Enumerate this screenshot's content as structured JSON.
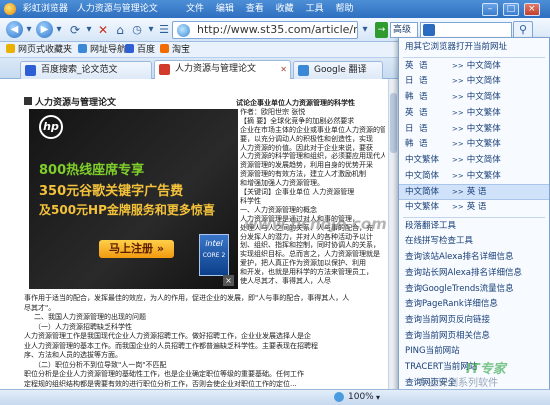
{
  "titlebar": {
    "app_name": "彩虹浏览器",
    "page_title": "人力资源与管理论文",
    "menu": [
      "文件",
      "编辑",
      "查看",
      "收藏",
      "工具",
      "帮助"
    ]
  },
  "address": {
    "url": "http://www.st35.com/article/manag",
    "go_label": "→",
    "engine": "高级",
    "search_value": ""
  },
  "favorites": [
    "网页式收藏夹",
    "网址导航",
    "百度",
    "淘宝"
  ],
  "tabs": [
    {
      "label": "百度搜索_论文范文",
      "active": false
    },
    {
      "label": "人力资源与管理论文",
      "active": true
    },
    {
      "label": "Google 翻译",
      "active": false
    }
  ],
  "document": {
    "heading": "人力资源与管理论文",
    "lines_right": [
      "试论企事业单位人力资源管理的科学性",
      "作者：欧阳世宗    张悦",
      "【摘 要】全球化竞争的加剧必然要求",
      "企业在市场主体的企业或事业单位人力资源的管理",
      "要，以充分调动人的积极性和创造性，实现",
      "人力资源的价值。因此对于企业来说，要获",
      "人力资源的科学管理和组织，必须要应用现代人力",
      "资源管理的发展趋势，利用自身的优势开采",
      "资源管理的有效方法，建立人才激励机制",
      "和增强加强人力资源管理。",
      "【关键词】企事业单位 人力资源管理",
      "科学性",
      "一、人力资源管理的概念",
      "人力资源管理是通过对人和事的管理，",
      "处理人与人之间的关系、人与事的配合，充",
      "分发挥人的潜力，并对人的各种活动予以计",
      "划、组织、指挥和控制，同时协调人的关系，",
      "实现组织目标。总而言之，人力资源管理就是",
      "爱护，把人真正作为资源加以保护、利用",
      "和开发，也就是用科学的方法来管理员工，",
      "使人尽其才、事得其人，人尽"
    ],
    "lines_full": [
      "事作用于适当的配合，发挥最佳的效应，为人的作用，促进企业的发展，即\"人与事的配合，事得其人，人",
      "尽其才\"。",
      "二、我国人力资源管理的出现的问题",
      "（一）人力资源招聘缺乏科学性",
      "人力资源管理工作是我国现代企业人力资源招聘工作。做好招聘工作，企业业发展选择人是企",
      "业人力资源管理的基本工作。而我国企业的人员招聘工作都普遍缺乏科学性。主要表现在招聘程",
      "序、方法和人员的选拔等方面。",
      "（二）职位分析不到位导致\"人一岗\"不匹配",
      "职位分析是企业人力资源管理的基础性工作，也是企业确定职位等级的重要基础。任何工作",
      "定程规的组织结构都是需要有效的进行职位分析工作，否则会使企业对职位工作的定位..."
    ]
  },
  "ad": {
    "brand": "hp",
    "line1": "800热线座席专享",
    "line2": "350元谷歌关键字广告费",
    "line3": "及500元HP金牌服务和更多惊喜",
    "button": "马上注册",
    "button_arrows": "»",
    "badge_line1": "intel",
    "badge_line2": "CORE 2",
    "close": "×"
  },
  "watermarks": {
    "main": "www.pcnoje.com",
    "green": "IT专家",
    "gray": "专业评测系列软件"
  },
  "dropdown": {
    "items": [
      {
        "type": "header",
        "label": "用其它浏览器打开当前网址"
      },
      {
        "type": "trans",
        "from": "英",
        "to": "语",
        "target": "中文简体"
      },
      {
        "type": "trans",
        "from": "日",
        "to": "语",
        "target": "中文简体"
      },
      {
        "type": "trans",
        "from": "韩",
        "to": "语",
        "target": "中文简体"
      },
      {
        "type": "trans",
        "from": "英",
        "to": "语",
        "target": "中文繁体"
      },
      {
        "type": "trans",
        "from": "日",
        "to": "语",
        "target": "中文繁体"
      },
      {
        "type": "trans",
        "from": "韩",
        "to": "语",
        "target": "中文繁体"
      },
      {
        "type": "trans",
        "from": "中文繁体",
        "to": "",
        "target": "中文简体"
      },
      {
        "type": "trans",
        "from": "中文简体",
        "to": "",
        "target": "中文繁体"
      },
      {
        "type": "trans",
        "from": "中文简体",
        "to": "",
        "target": "英   语",
        "selected": true
      },
      {
        "type": "trans",
        "from": "中文繁体",
        "to": "",
        "target": "英   语"
      },
      {
        "type": "plain",
        "label": "段落翻译工具"
      },
      {
        "type": "plain",
        "label": "在线拼写检查工具"
      },
      {
        "type": "plain",
        "label": "查询该站Alexa排名详细信息"
      },
      {
        "type": "plain",
        "label": "查询站长网Alexa排名详细信息"
      },
      {
        "type": "plain",
        "label": "查询GoogleTrends流量信息"
      },
      {
        "type": "plain",
        "label": "查询PageRank详细信息"
      },
      {
        "type": "plain",
        "label": "查询当前网页反向链接"
      },
      {
        "type": "plain",
        "label": "查询当前网页相关信息"
      },
      {
        "type": "plain",
        "label": "PING当前网站"
      },
      {
        "type": "plain",
        "label": "TRACERT当前网站"
      },
      {
        "type": "plain",
        "label": "查询网页安全"
      }
    ]
  },
  "status": {
    "zoom": "100%",
    "left_text": ""
  }
}
